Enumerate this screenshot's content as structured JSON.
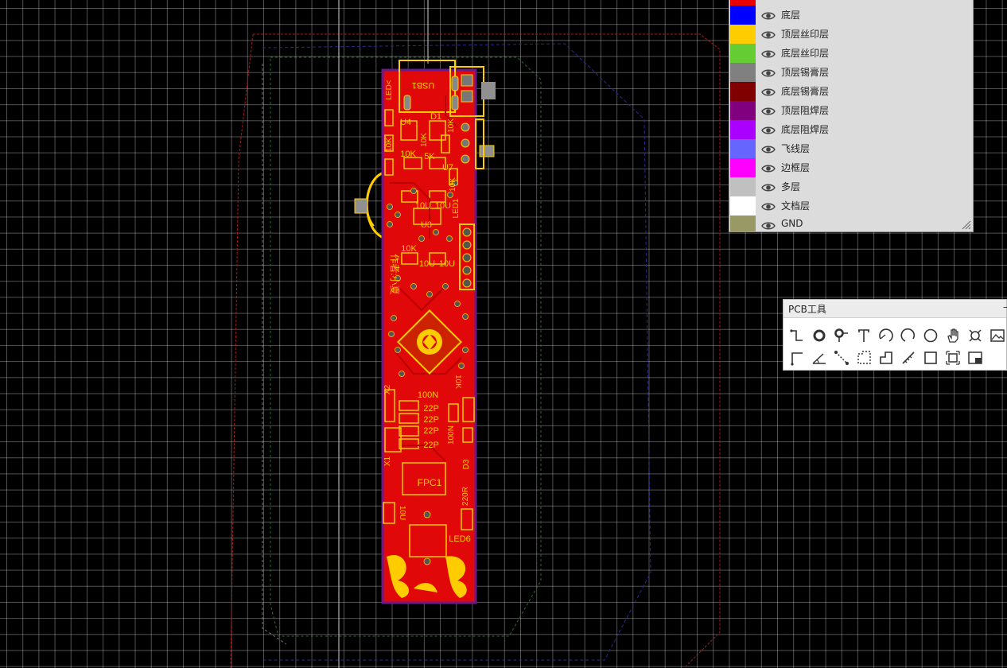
{
  "layers_panel": {
    "layers": [
      {
        "name": "底层",
        "color": "#0000ff"
      },
      {
        "name": "顶层丝印层",
        "color": "#ffcc00"
      },
      {
        "name": "底层丝印层",
        "color": "#66cc33"
      },
      {
        "name": "顶层锡膏层",
        "color": "#808080"
      },
      {
        "name": "底层锡膏层",
        "color": "#800000"
      },
      {
        "name": "顶层阻焊层",
        "color": "#800080"
      },
      {
        "name": "底层阻焊层",
        "color": "#aa00ff"
      },
      {
        "name": "飞线层",
        "color": "#6666ff"
      },
      {
        "name": "边框层",
        "color": "#ff00ff"
      },
      {
        "name": "多层",
        "color": "#c0c0c0"
      },
      {
        "name": "文档层",
        "color": "#ffffff"
      },
      {
        "name": "GND",
        "color": "#999966"
      }
    ]
  },
  "pcb_tools": {
    "title": "PCB工具",
    "minimize": "–",
    "tools_row1": [
      "wire-icon",
      "pad-icon",
      "via-icon",
      "text-icon",
      "arc-icon",
      "arc-ccw-icon",
      "circle-icon",
      "hand-icon",
      "target-icon",
      "image-icon"
    ],
    "tools_row2": [
      "track-icon",
      "angle-icon",
      "dimension-icon",
      "region-icon",
      "polygon-icon",
      "ruler-icon",
      "rect-icon",
      "group-icon",
      "layout-icon"
    ]
  },
  "board_labels": {
    "usb": "USB1",
    "d1": "D1",
    "u4": "U4",
    "r_10k_a": "10K",
    "r_10k_b": "10K",
    "r_10k_c": "10K",
    "r_10k_d": "10K",
    "r_5k": "5K",
    "u7": "U7",
    "r_10k_e": "10K",
    "c_10u_a": "10U",
    "c_10u_b": "10U",
    "led1": "LED1",
    "u3": "U3",
    "r_10k_f": "10K",
    "c_10u_c": "10U",
    "c_10u_d": "10U",
    "author": "作者:小夏",
    "x2": "X2",
    "c_100n_a": "100N",
    "c_22p_a": "22P",
    "c_22p_b": "22P",
    "c_22p_c": "22P",
    "c_22p_d": "22P",
    "r_10k_g": "10K",
    "c_100n_b": "100N",
    "d3": "D3",
    "x1": "X1",
    "fpc1": "FPC1",
    "r_220r": "220R",
    "c_10u_e": "10U",
    "led6": "LED6",
    "led_arrow": "LED<"
  }
}
